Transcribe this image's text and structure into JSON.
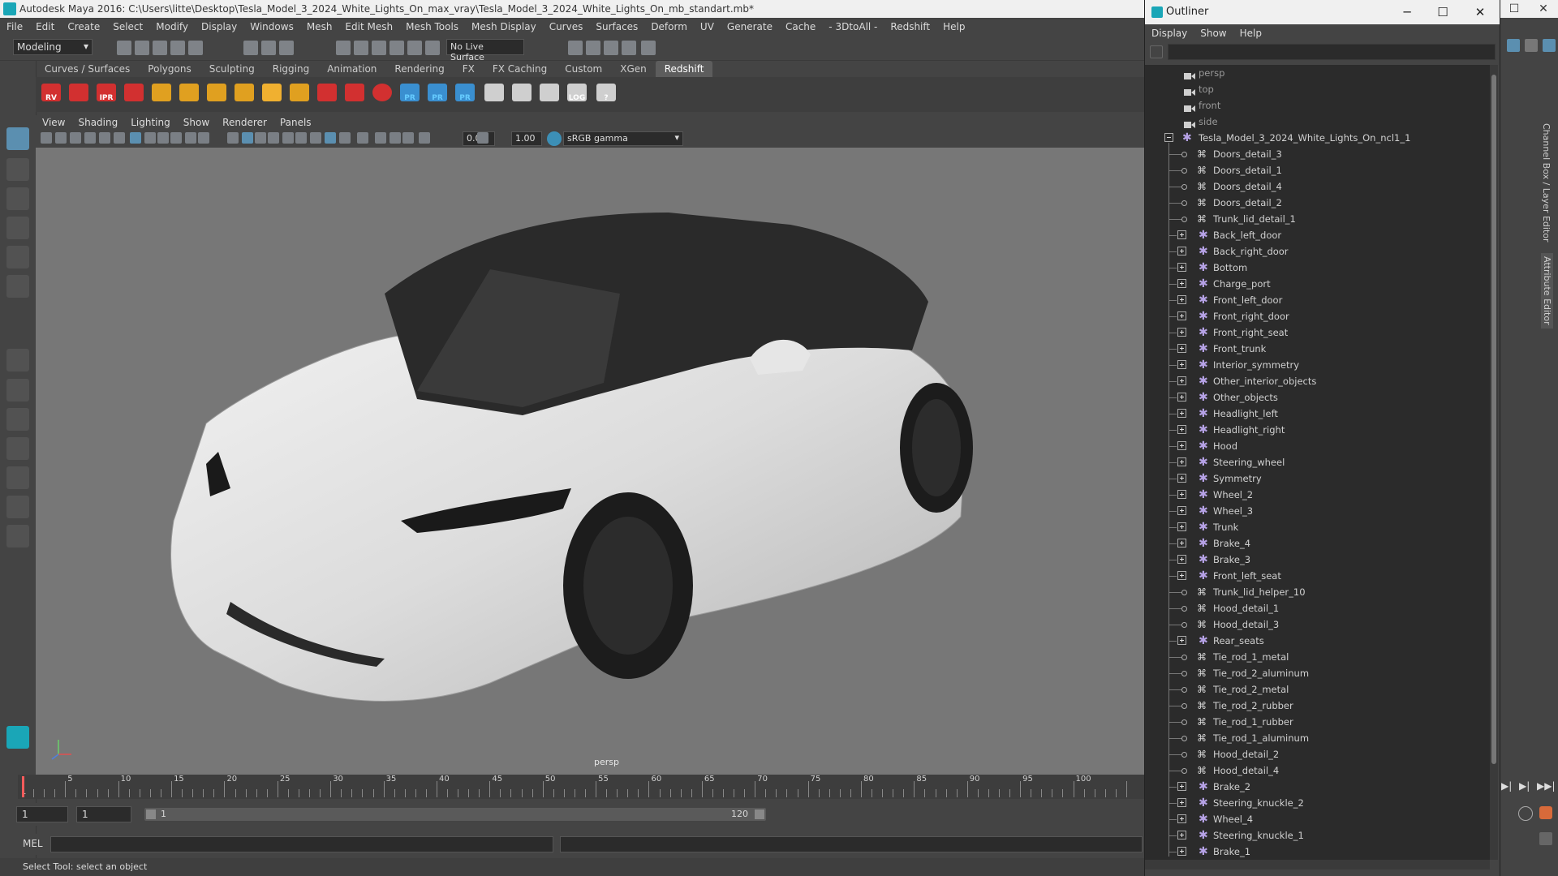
{
  "window": {
    "title": "Autodesk Maya 2016: C:\\Users\\litte\\Desktop\\Tesla_Model_3_2024_White_Lights_On_max_vray\\Tesla_Model_3_2024_White_Lights_On_mb_standart.mb*",
    "minimize": "─",
    "maximize": "☐",
    "close": "✕"
  },
  "menubar": [
    "File",
    "Edit",
    "Create",
    "Select",
    "Modify",
    "Display",
    "Windows",
    "Mesh",
    "Edit Mesh",
    "Mesh Tools",
    "Mesh Display",
    "Curves",
    "Surfaces",
    "Deform",
    "UV",
    "Generate",
    "Cache",
    "- 3DtoAll -",
    "Redshift",
    "Help"
  ],
  "statusline": {
    "mode": "Modeling",
    "live_surface": "No Live Surface"
  },
  "shelf": {
    "tabs": [
      "Curves / Surfaces",
      "Polygons",
      "Sculpting",
      "Rigging",
      "Animation",
      "Rendering",
      "FX",
      "FX Caching",
      "Custom",
      "XGen",
      "Redshift"
    ],
    "active_tab": "Redshift",
    "icons": [
      "RV",
      "",
      "IPR",
      "",
      "",
      "",
      "",
      "",
      "",
      "",
      "",
      "",
      "",
      "PR",
      "PR",
      "PR",
      "",
      "",
      "",
      "LOG",
      "?"
    ]
  },
  "panel": {
    "menus": [
      "View",
      "Shading",
      "Lighting",
      "Show",
      "Renderer",
      "Panels"
    ],
    "exposure": "0.00",
    "gamma": "1.00",
    "colorspace": "sRGB gamma",
    "camera_label": "persp"
  },
  "timeline": {
    "ticks": [
      "5",
      "10",
      "15",
      "20",
      "25",
      "30",
      "35",
      "40",
      "45",
      "50",
      "55",
      "60",
      "65",
      "70",
      "75",
      "80",
      "85",
      "90",
      "95",
      "100"
    ],
    "current_frame": "1",
    "range_start": "1",
    "range_start_inner": "1",
    "range_slider_start": "1",
    "range_slider_end": "120"
  },
  "cmdline": {
    "label": "MEL"
  },
  "helpline": {
    "text": "Select Tool: select an object"
  },
  "outliner": {
    "title": "Outliner",
    "menus": [
      "Display",
      "Show",
      "Help"
    ],
    "cameras": [
      "persp",
      "top",
      "front",
      "side"
    ],
    "root": "Tesla_Model_3_2024_White_Lights_On_ncl1_1",
    "children": [
      {
        "name": "Doors_detail_3",
        "kind": "mesh"
      },
      {
        "name": "Doors_detail_1",
        "kind": "mesh"
      },
      {
        "name": "Doors_detail_4",
        "kind": "mesh"
      },
      {
        "name": "Doors_detail_2",
        "kind": "mesh"
      },
      {
        "name": "Trunk_lid_detail_1",
        "kind": "mesh"
      },
      {
        "name": "Back_left_door",
        "kind": "group"
      },
      {
        "name": "Back_right_door",
        "kind": "group"
      },
      {
        "name": "Bottom",
        "kind": "group"
      },
      {
        "name": "Charge_port",
        "kind": "group"
      },
      {
        "name": "Front_left_door",
        "kind": "group"
      },
      {
        "name": "Front_right_door",
        "kind": "group"
      },
      {
        "name": "Front_right_seat",
        "kind": "group"
      },
      {
        "name": "Front_trunk",
        "kind": "group"
      },
      {
        "name": "Interior_symmetry",
        "kind": "group"
      },
      {
        "name": "Other_interior_objects",
        "kind": "group"
      },
      {
        "name": "Other_objects",
        "kind": "group"
      },
      {
        "name": "Headlight_left",
        "kind": "group"
      },
      {
        "name": "Headlight_right",
        "kind": "group"
      },
      {
        "name": "Hood",
        "kind": "group"
      },
      {
        "name": "Steering_wheel",
        "kind": "group"
      },
      {
        "name": "Symmetry",
        "kind": "group"
      },
      {
        "name": "Wheel_2",
        "kind": "group"
      },
      {
        "name": "Wheel_3",
        "kind": "group"
      },
      {
        "name": "Trunk",
        "kind": "group"
      },
      {
        "name": "Brake_4",
        "kind": "group"
      },
      {
        "name": "Brake_3",
        "kind": "group"
      },
      {
        "name": "Front_left_seat",
        "kind": "group"
      },
      {
        "name": "Trunk_lid_helper_10",
        "kind": "mesh"
      },
      {
        "name": "Hood_detail_1",
        "kind": "mesh"
      },
      {
        "name": "Hood_detail_3",
        "kind": "mesh"
      },
      {
        "name": "Rear_seats",
        "kind": "group"
      },
      {
        "name": "Tie_rod_1_metal",
        "kind": "mesh"
      },
      {
        "name": "Tie_rod_2_aluminum",
        "kind": "mesh"
      },
      {
        "name": "Tie_rod_2_metal",
        "kind": "mesh"
      },
      {
        "name": "Tie_rod_2_rubber",
        "kind": "mesh"
      },
      {
        "name": "Tie_rod_1_rubber",
        "kind": "mesh"
      },
      {
        "name": "Tie_rod_1_aluminum",
        "kind": "mesh"
      },
      {
        "name": "Hood_detail_2",
        "kind": "mesh"
      },
      {
        "name": "Hood_detail_4",
        "kind": "mesh"
      },
      {
        "name": "Brake_2",
        "kind": "group"
      },
      {
        "name": "Steering_knuckle_2",
        "kind": "group"
      },
      {
        "name": "Wheel_4",
        "kind": "group"
      },
      {
        "name": "Steering_knuckle_1",
        "kind": "group"
      },
      {
        "name": "Brake_1",
        "kind": "group"
      }
    ]
  },
  "right_tabs": [
    "Channel Box / Layer Editor",
    "Attribute Editor"
  ]
}
